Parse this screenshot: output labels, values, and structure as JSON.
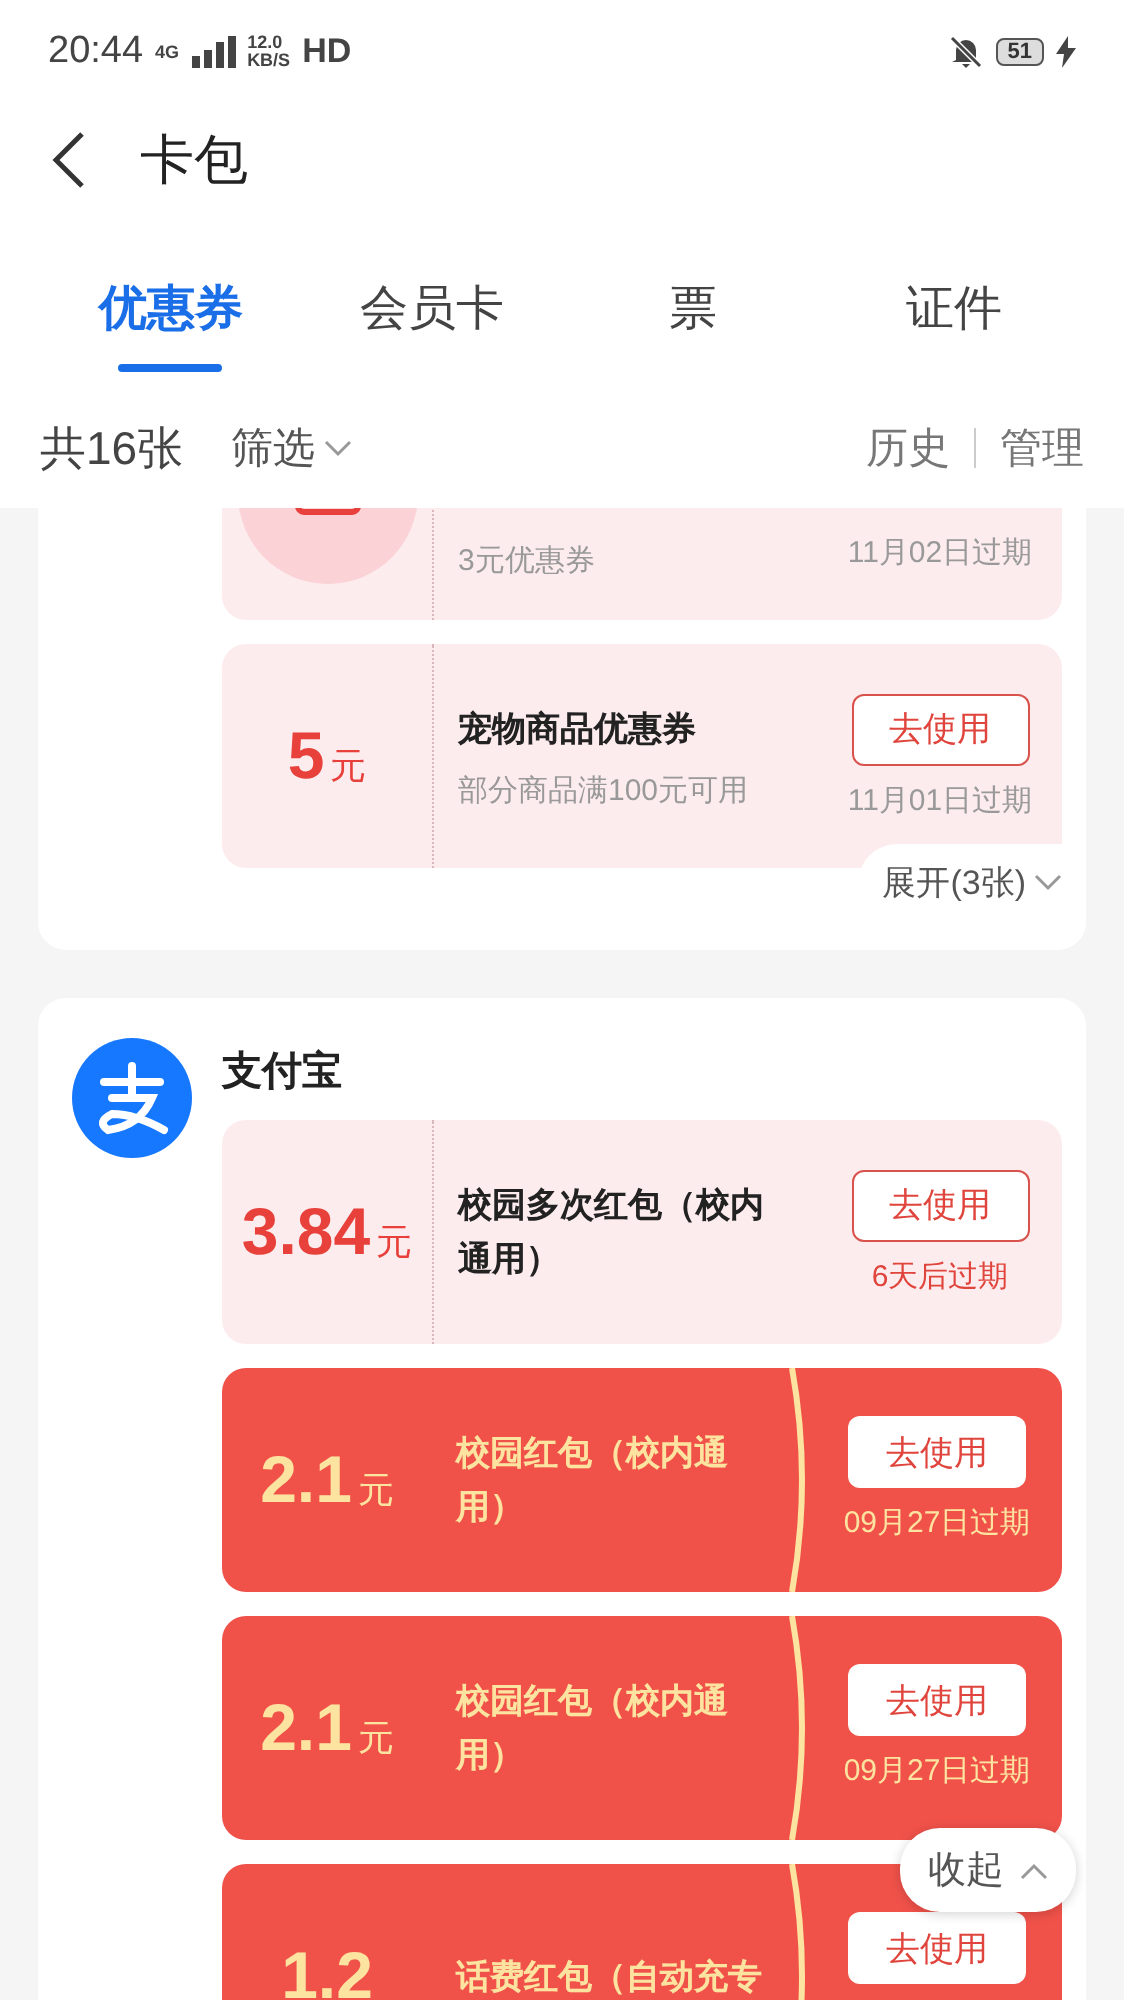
{
  "status_bar": {
    "time": "20:44",
    "network": "4G",
    "speed": "12.0",
    "speed_unit": "KB/S",
    "hd": "HD",
    "battery": "51"
  },
  "header": {
    "title": "卡包"
  },
  "tabs": [
    {
      "label": "优惠券",
      "selected": true
    },
    {
      "label": "会员卡",
      "selected": false
    },
    {
      "label": "票",
      "selected": false
    },
    {
      "label": "证件",
      "selected": false
    }
  ],
  "toolbar": {
    "count": "共16张",
    "filter": "筛选",
    "history": "历史",
    "manage": "管理"
  },
  "merchants": [
    {
      "expand": "展开(3张)",
      "coupons": [
        {
          "kind": "plain",
          "subtitle": "3元优惠券",
          "expiry": "11月02日过期",
          "urgent": false
        },
        {
          "kind": "plain",
          "amount": "5",
          "unit": "元",
          "title": "宠物商品优惠券",
          "subtitle": "部分商品满100元可用",
          "button": "去使用",
          "expiry": "11月01日过期",
          "urgent": false
        }
      ]
    },
    {
      "name": "支付宝",
      "coupons": [
        {
          "kind": "plain",
          "amount": "3.84",
          "unit": "元",
          "title": "校园多次红包（校内通用）",
          "button": "去使用",
          "expiry": "6天后过期",
          "urgent": true
        },
        {
          "kind": "red",
          "amount": "2.1",
          "unit": "元",
          "title": "校园红包（校内通用）",
          "button": "去使用",
          "expiry": "09月27日过期"
        },
        {
          "kind": "red",
          "amount": "2.1",
          "unit": "元",
          "title": "校园红包（校内通用）",
          "button": "去使用",
          "expiry": "09月27日过期"
        },
        {
          "kind": "red",
          "amount": "1.2",
          "title": "话费红包（自动充专",
          "button": "去使用"
        }
      ]
    }
  ],
  "collapse": "收起"
}
